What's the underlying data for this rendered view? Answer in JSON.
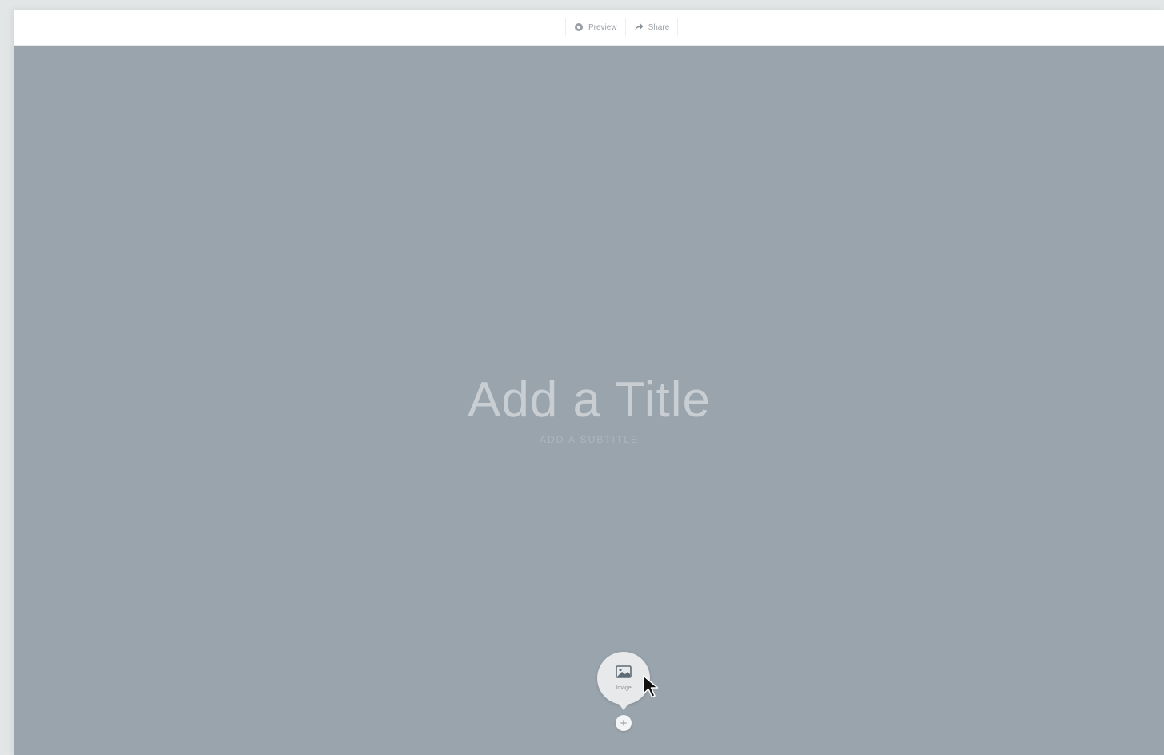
{
  "toolbar": {
    "preview_label": "Preview",
    "preview_icon": "eye-icon",
    "share_label": "Share",
    "share_icon": "share-arrow-icon"
  },
  "hero": {
    "background_color": "#9aa4ad",
    "title_placeholder": "Add a Title",
    "subtitle_placeholder": "ADD A SUBTITLE"
  },
  "media_picker": {
    "icon": "image-icon",
    "label": "Image"
  },
  "add_button": {
    "icon": "plus-icon",
    "label": "+"
  }
}
